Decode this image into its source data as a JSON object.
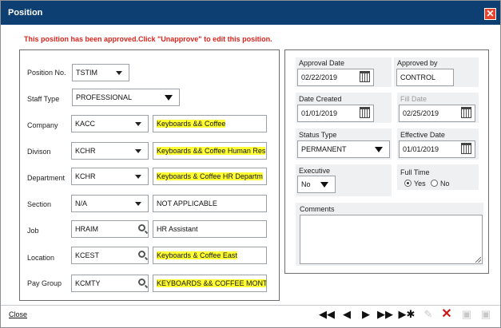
{
  "window": {
    "title": "Position",
    "approved_message": "This position has been approved.Click \"Unapprove\" to edit this position."
  },
  "left_form": {
    "position_no": {
      "label": "Position No.",
      "value": "TSTIM"
    },
    "staff_type": {
      "label": "Staff Type",
      "value": "PROFESSIONAL"
    },
    "company": {
      "label": "Company",
      "value": "KACC",
      "desc": "Keyboards && Coffee"
    },
    "division": {
      "label": "Divison",
      "value": "KCHR",
      "desc": "Keyboards && Coffee Human Res"
    },
    "department": {
      "label": "Department",
      "value": "KCHR",
      "desc": "Keyboards & Coffee HR Departm"
    },
    "section": {
      "label": "Section",
      "value": "N/A",
      "desc": "NOT APPLICABLE"
    },
    "job": {
      "label": "Job",
      "value": "HRAIM",
      "desc": "HR Assistant"
    },
    "location": {
      "label": "Location",
      "value": "KCEST",
      "desc": "Keyboards & Coffee East"
    },
    "pay_group": {
      "label": "Pay Group",
      "value": "KCMTY",
      "desc": "KEYBOARDS && COFFEE MONTH"
    }
  },
  "right_form": {
    "approval_date": {
      "label": "Approval Date",
      "value": "02/22/2019"
    },
    "approved_by": {
      "label": "Approved by",
      "value": "CONTROL"
    },
    "date_created": {
      "label": "Date Created",
      "value": "01/01/2019"
    },
    "fill_date": {
      "label": "Fill Date",
      "value": "02/25/2019"
    },
    "status_type": {
      "label": "Status Type",
      "value": "PERMANENT"
    },
    "effective_date": {
      "label": "Effective Date",
      "value": "01/01/2019"
    },
    "executive": {
      "label": "Executive",
      "value": "No"
    },
    "full_time": {
      "label": "Full Time",
      "yes": "Yes",
      "no": "No",
      "selected": "Yes"
    },
    "comments": {
      "label": "Comments",
      "value": ""
    }
  },
  "footer": {
    "close_label": "Close",
    "nav_icons": [
      "first-icon",
      "previous-icon",
      "next-icon",
      "last-icon",
      "new-record-icon",
      "edit-icon",
      "delete-icon",
      "save-icon",
      "save-as-icon"
    ]
  },
  "colors": {
    "titlebar": "#0e3f73",
    "highlight": "#ffff33",
    "message": "#d9241c",
    "close": "#e8432c"
  }
}
